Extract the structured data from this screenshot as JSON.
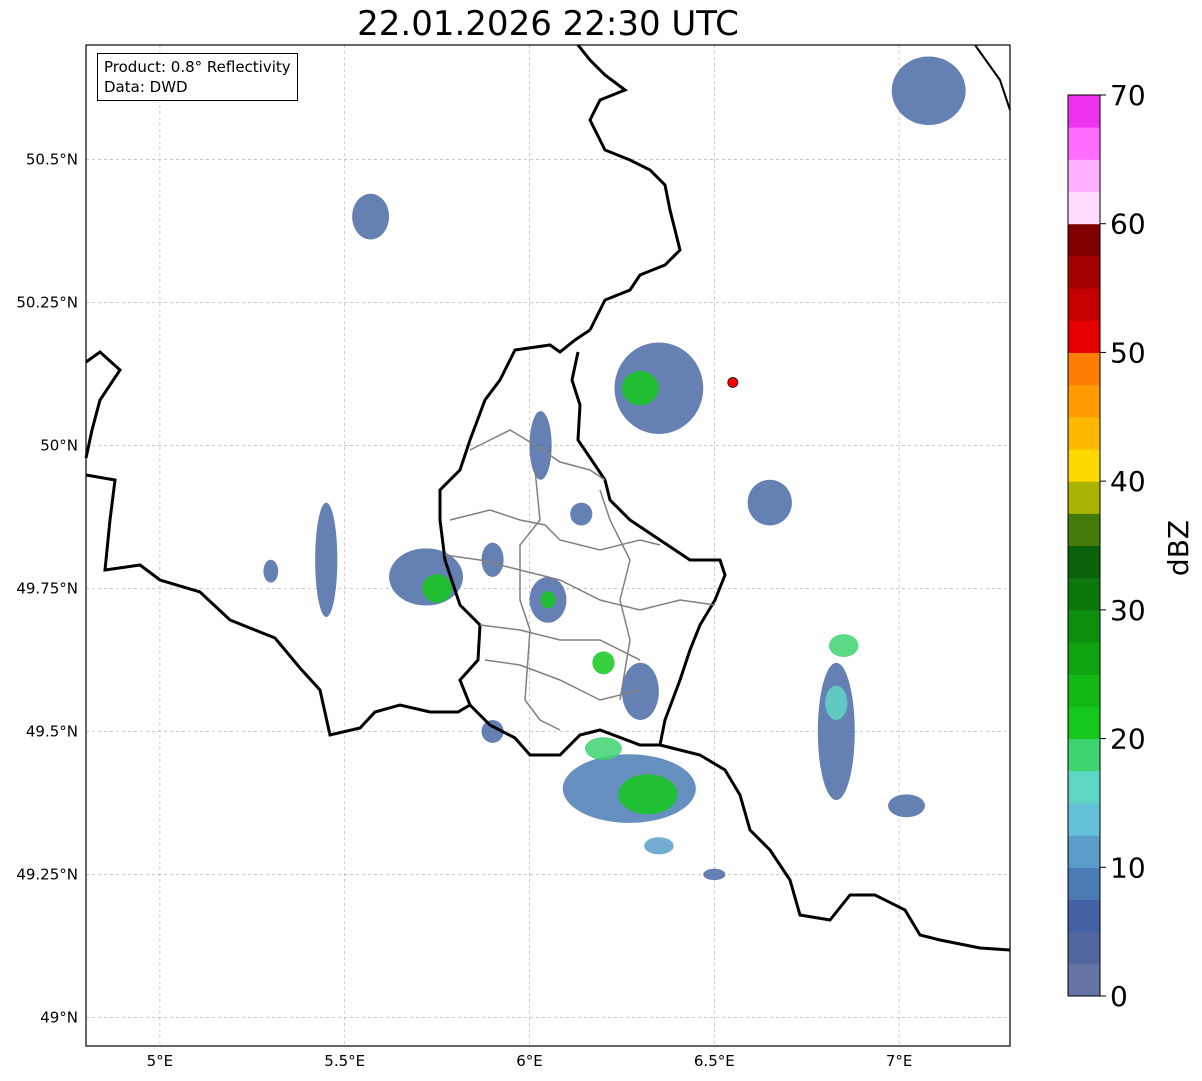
{
  "title": "22.01.2026 22:30 UTC",
  "info_box": {
    "product": "Product: 0.8° Reflectivity",
    "data": "Data: DWD"
  },
  "map": {
    "lon_range": [
      4.8,
      7.3
    ],
    "lat_range": [
      48.95,
      50.7
    ],
    "lon_ticks": [
      {
        "value": 5.0,
        "label": "5°E"
      },
      {
        "value": 5.5,
        "label": "5.5°E"
      },
      {
        "value": 6.0,
        "label": "6°E"
      },
      {
        "value": 6.5,
        "label": "6.5°E"
      },
      {
        "value": 7.0,
        "label": "7°E"
      }
    ],
    "lat_ticks": [
      {
        "value": 49.0,
        "label": "49°N"
      },
      {
        "value": 49.25,
        "label": "49.25°N"
      },
      {
        "value": 49.5,
        "label": "49.5°N"
      },
      {
        "value": 49.75,
        "label": "49.75°N"
      },
      {
        "value": 50.0,
        "label": "50°N"
      },
      {
        "value": 50.25,
        "label": "50.25°N"
      },
      {
        "value": 50.5,
        "label": "50.5°N"
      }
    ],
    "grid": true,
    "radar_site": {
      "lon": 6.55,
      "lat": 50.11,
      "color": "#ff0000"
    }
  },
  "colorbar": {
    "unit": "dBZ",
    "range": [
      0,
      70
    ],
    "ticks": [
      {
        "value": 0,
        "label": "0"
      },
      {
        "value": 10,
        "label": "10"
      },
      {
        "value": 20,
        "label": "20"
      },
      {
        "value": 30,
        "label": "30"
      },
      {
        "value": 40,
        "label": "40"
      },
      {
        "value": 50,
        "label": "50"
      },
      {
        "value": 60,
        "label": "60"
      },
      {
        "value": 70,
        "label": "70"
      }
    ],
    "colors": [
      "#6674a8",
      "#52679f",
      "#4361a5",
      "#4a7bb3",
      "#5a9dc9",
      "#63c2d9",
      "#5fd6c4",
      "#3dd36e",
      "#14c81c",
      "#12b814",
      "#10a310",
      "#0e8e0e",
      "#0c780c",
      "#0a620a",
      "#457a0a",
      "#aab304",
      "#ffd800",
      "#ffb800",
      "#ff9a00",
      "#ff7d00",
      "#e50000",
      "#c50000",
      "#a30000",
      "#800000",
      "#ffdcff",
      "#ffb0ff",
      "#ff6cff",
      "#ee33ee"
    ]
  },
  "echoes": [
    {
      "lon": 5.57,
      "lat": 50.4,
      "rx": 0.05,
      "ry": 0.04,
      "color": "#4a6aa6"
    },
    {
      "lon": 5.45,
      "lat": 49.8,
      "rx": 0.03,
      "ry": 0.1,
      "color": "#4a6aa6"
    },
    {
      "lon": 5.72,
      "lat": 49.77,
      "rx": 0.1,
      "ry": 0.05,
      "color": "#4a6aa6"
    },
    {
      "lon": 5.75,
      "lat": 49.75,
      "rx": 0.04,
      "ry": 0.025,
      "color": "#14c81c"
    },
    {
      "lon": 6.27,
      "lat": 49.4,
      "rx": 0.18,
      "ry": 0.06,
      "color": "#4a7bb3"
    },
    {
      "lon": 6.32,
      "lat": 49.39,
      "rx": 0.08,
      "ry": 0.035,
      "color": "#14c81c"
    },
    {
      "lon": 6.2,
      "lat": 49.47,
      "rx": 0.05,
      "ry": 0.02,
      "color": "#3dd36e"
    },
    {
      "lon": 6.3,
      "lat": 49.57,
      "rx": 0.05,
      "ry": 0.05,
      "color": "#4a6aa6"
    },
    {
      "lon": 6.2,
      "lat": 49.62,
      "rx": 0.03,
      "ry": 0.02,
      "color": "#14c81c"
    },
    {
      "lon": 6.05,
      "lat": 49.73,
      "rx": 0.05,
      "ry": 0.04,
      "color": "#4a6aa6"
    },
    {
      "lon": 6.05,
      "lat": 49.73,
      "rx": 0.02,
      "ry": 0.015,
      "color": "#14c81c"
    },
    {
      "lon": 6.35,
      "lat": 50.1,
      "rx": 0.12,
      "ry": 0.08,
      "color": "#4a6aa6"
    },
    {
      "lon": 6.3,
      "lat": 50.1,
      "rx": 0.05,
      "ry": 0.03,
      "color": "#14c81c"
    },
    {
      "lon": 6.03,
      "lat": 50.0,
      "rx": 0.03,
      "ry": 0.06,
      "color": "#4a6aa6"
    },
    {
      "lon": 6.83,
      "lat": 49.5,
      "rx": 0.05,
      "ry": 0.12,
      "color": "#4a6aa6"
    },
    {
      "lon": 6.83,
      "lat": 49.55,
      "rx": 0.03,
      "ry": 0.03,
      "color": "#5fd6c4"
    },
    {
      "lon": 6.85,
      "lat": 49.65,
      "rx": 0.04,
      "ry": 0.02,
      "color": "#3dd36e"
    },
    {
      "lon": 7.02,
      "lat": 49.37,
      "rx": 0.05,
      "ry": 0.02,
      "color": "#4a6aa6"
    },
    {
      "lon": 7.08,
      "lat": 50.62,
      "rx": 0.1,
      "ry": 0.06,
      "color": "#4a6aa6"
    },
    {
      "lon": 6.65,
      "lat": 49.9,
      "rx": 0.06,
      "ry": 0.04,
      "color": "#4a6aa6"
    },
    {
      "lon": 6.35,
      "lat": 49.3,
      "rx": 0.04,
      "ry": 0.015,
      "color": "#5a9dc9"
    },
    {
      "lon": 5.9,
      "lat": 49.8,
      "rx": 0.03,
      "ry": 0.03,
      "color": "#4a6aa6"
    },
    {
      "lon": 6.14,
      "lat": 49.88,
      "rx": 0.03,
      "ry": 0.02,
      "color": "#4a6aa6"
    },
    {
      "lon": 5.3,
      "lat": 49.78,
      "rx": 0.02,
      "ry": 0.02,
      "color": "#4a6aa6"
    },
    {
      "lon": 5.9,
      "lat": 49.5,
      "rx": 0.03,
      "ry": 0.02,
      "color": "#4a6aa6"
    },
    {
      "lon": 6.5,
      "lat": 49.25,
      "rx": 0.03,
      "ry": 0.01,
      "color": "#4a6aa6"
    }
  ]
}
